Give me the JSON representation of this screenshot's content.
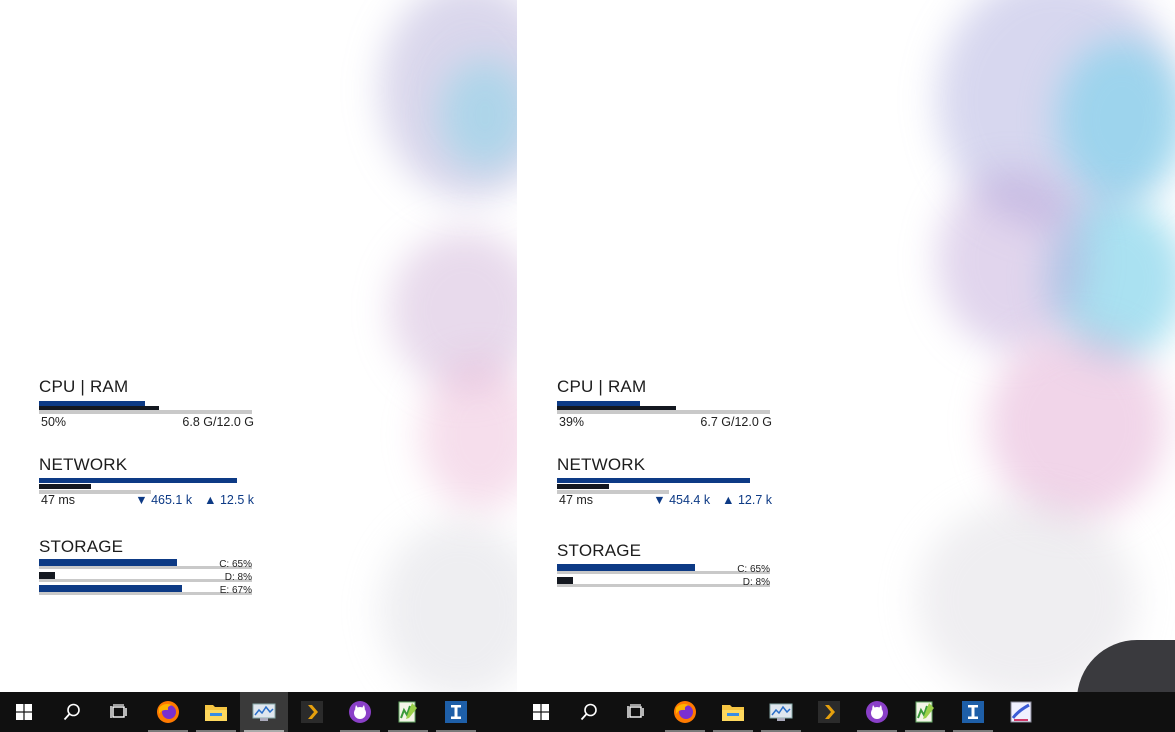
{
  "colors": {
    "accent": "#0d3a85",
    "dark_bar": "#141820",
    "track": "#c9c9c9",
    "taskbar": "#101010"
  },
  "left": {
    "cpu_ram": {
      "title": "CPU | RAM",
      "cpu_percent": "50%",
      "cpu_fraction": 0.5,
      "ram_text": "6.8 G/12.0 G",
      "ram_fraction": 0.567
    },
    "network": {
      "title": "NETWORK",
      "ping": "47 ms",
      "down": "▼ 465.1 k",
      "up": "▲ 12.5 k",
      "down_fraction": 0.93,
      "up_fraction": 0.24
    },
    "storage": {
      "title": "STORAGE",
      "drives": [
        {
          "label": "C: 65%",
          "fraction": 0.65
        },
        {
          "label": "D: 8%",
          "fraction": 0.08
        },
        {
          "label": "E: 67%",
          "fraction": 0.67
        }
      ]
    }
  },
  "right": {
    "cpu_ram": {
      "title": "CPU | RAM",
      "cpu_percent": "39%",
      "cpu_fraction": 0.39,
      "ram_text": "6.7 G/12.0 G",
      "ram_fraction": 0.558
    },
    "network": {
      "title": "NETWORK",
      "ping": "47 ms",
      "down": "▼ 454.4 k",
      "up": "▲ 12.7 k",
      "down_fraction": 0.91,
      "up_fraction": 0.24
    },
    "storage": {
      "title": "STORAGE",
      "drives": [
        {
          "label": "C: 65%",
          "fraction": 0.65
        },
        {
          "label": "D: 8%",
          "fraction": 0.08
        }
      ]
    }
  },
  "taskbar": {
    "left_icons": [
      "windows-start-icon",
      "search-icon",
      "task-view-icon",
      "firefox-icon",
      "file-explorer-icon",
      "resource-monitor-icon",
      "plex-icon",
      "cat-app-icon",
      "notepad-plus-plus-icon",
      "text-editor-icon"
    ],
    "right_icons": [
      "windows-start-icon",
      "search-icon",
      "task-view-icon",
      "firefox-icon",
      "file-explorer-icon",
      "resource-monitor-icon",
      "plex-icon",
      "cat-app-icon",
      "notepad-plus-plus-icon",
      "text-editor-icon",
      "paint-icon"
    ]
  }
}
